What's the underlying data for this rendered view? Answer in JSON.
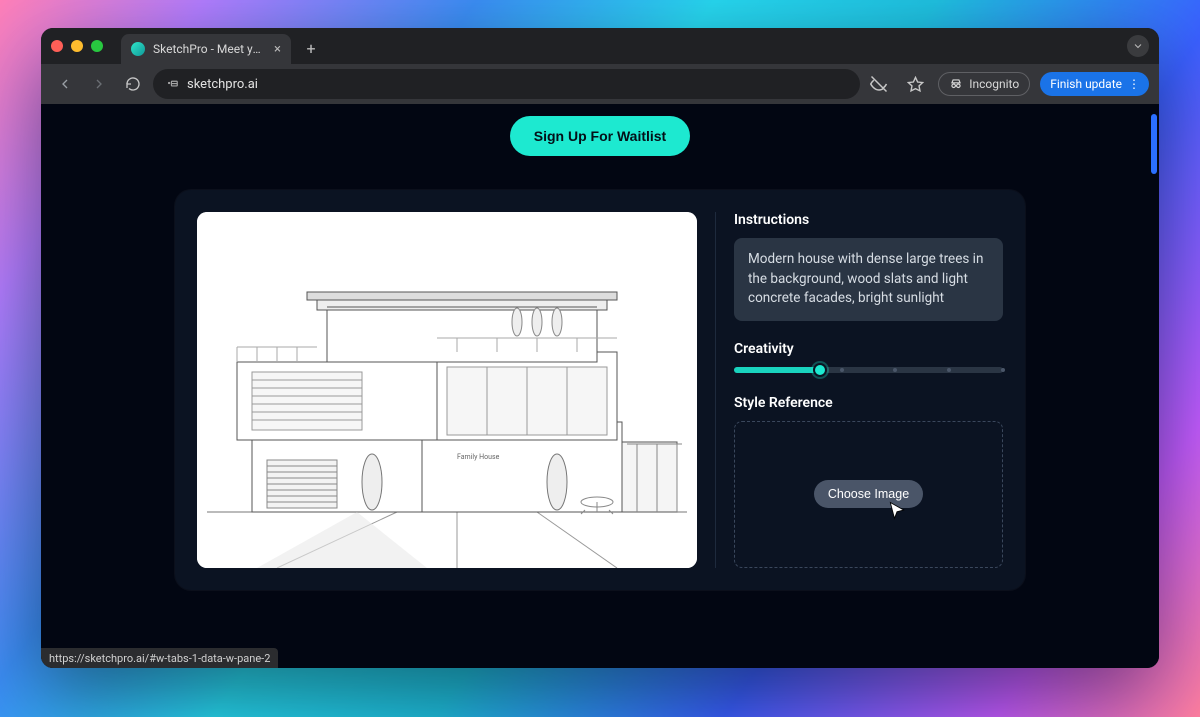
{
  "browser": {
    "tab_title": "SketchPro - Meet your desig…",
    "url_display": "sketchpro.ai",
    "incognito_label": "Incognito",
    "finish_update_label": "Finish update",
    "status_url": "https://sketchpro.ai/#w-tabs-1-data-w-pane-2"
  },
  "page": {
    "waitlist_button": "Sign Up For Waitlist",
    "sketch_caption": "Family House",
    "instructions_label": "Instructions",
    "instructions_text": "Modern house with dense large trees in the background, wood slats and light concrete facades, bright sunlight",
    "creativity_label": "Creativity",
    "creativity_value_pct": 32,
    "style_ref_label": "Style Reference",
    "choose_image_label": "Choose Image"
  },
  "colors": {
    "accent": "#1de9d0",
    "card_bg": "#0b1322",
    "panel_bg": "#2a3544"
  }
}
